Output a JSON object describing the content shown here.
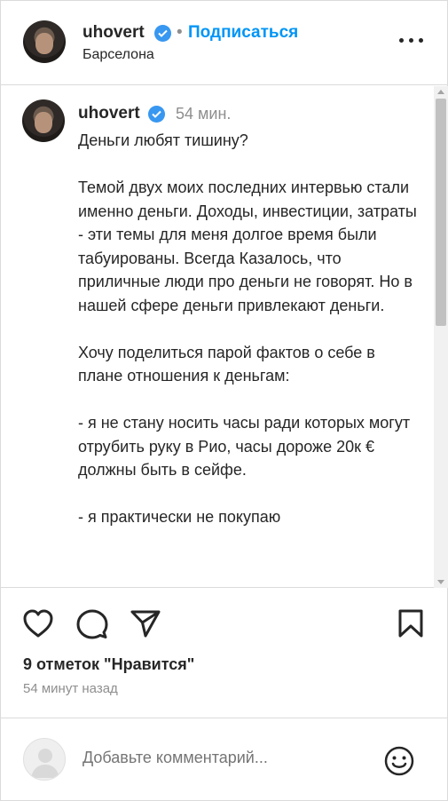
{
  "header": {
    "username": "uhovert",
    "separator": "•",
    "follow_label": "Подписаться",
    "location": "Барселона"
  },
  "caption": {
    "username": "uhovert",
    "time": "54 мин.",
    "paragraphs": [
      "Деньги любят тишину?",
      "Темой двух моих последних интервью стали именно деньги. Доходы, инвестиции, затраты - эти темы для меня долгое время были табуированы. Всегда Казалось, что приличные люди про деньги не говорят. Но в нашей сфере деньги привлекают деньги.",
      "Хочу поделиться парой фактов о себе в плане отношения к деньгам:",
      "- я не стану носить часы ради которых могут отрубить руку в Рио, часы дороже 20к € должны быть в сейфе.",
      "- я практически не покупаю"
    ]
  },
  "actions": {
    "likes_text": "9 отметок \"Нравится\"",
    "posted_ago": "54 минут назад"
  },
  "comment_bar": {
    "placeholder": "Добавьте комментарий..."
  },
  "icons": {
    "like": "heart-icon",
    "comment": "comment-bubble-icon",
    "share": "paper-plane-icon",
    "save": "bookmark-icon",
    "emoji": "smiley-icon",
    "verified": "verified-badge-icon",
    "more": "more-dots-icon"
  },
  "colors": {
    "accent": "#0095f6",
    "verified": "#3897f0",
    "text": "#262626",
    "muted": "#8e8e8e"
  }
}
